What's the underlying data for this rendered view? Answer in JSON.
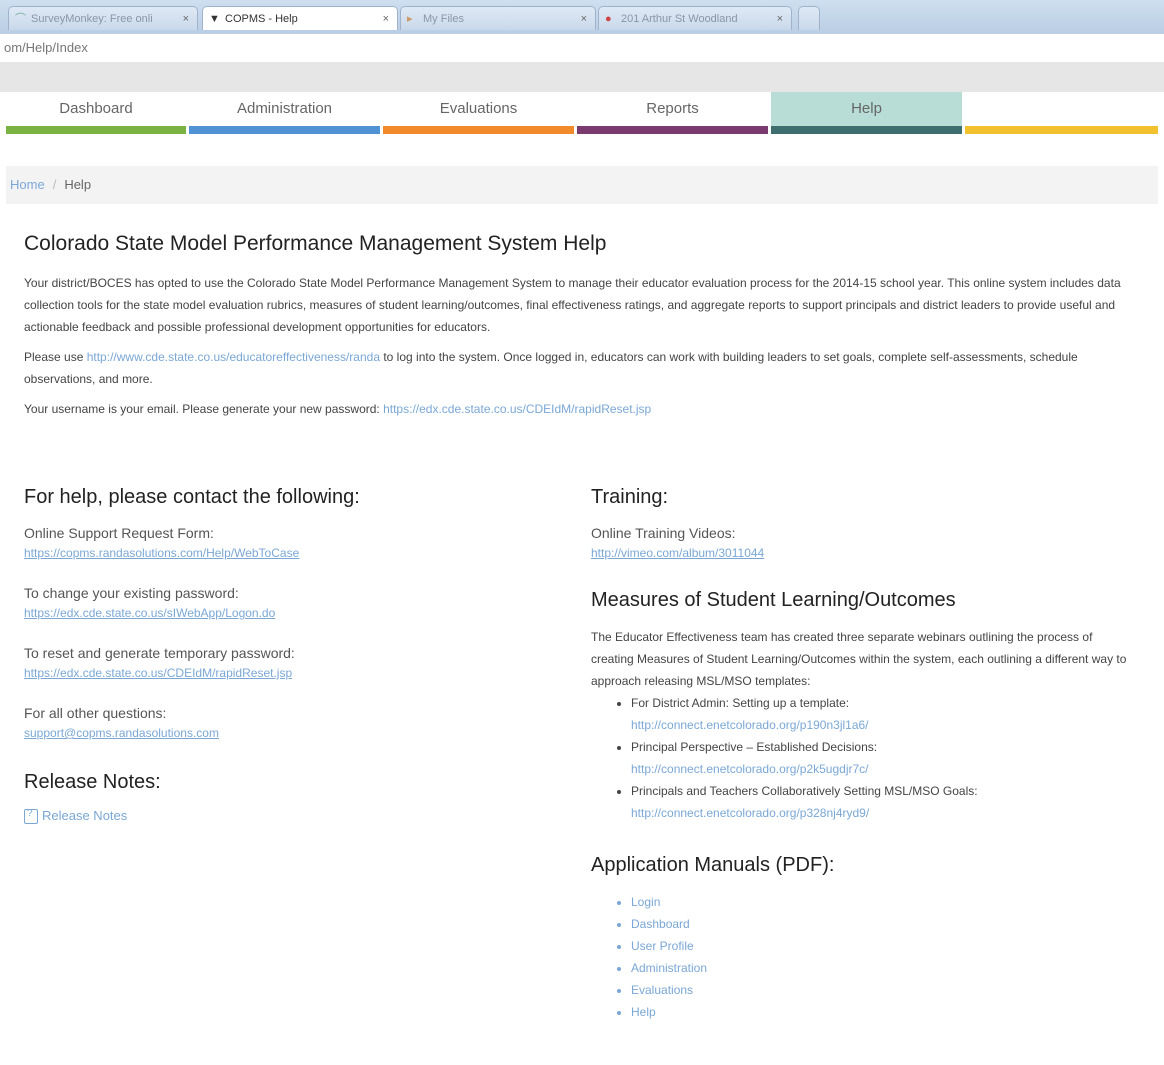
{
  "browser": {
    "tabs": [
      {
        "label": "SurveyMonkey: Free onli",
        "icon": "surveymonkey-icon",
        "active": false
      },
      {
        "label": "COPMS - Help",
        "icon": "copms-icon",
        "active": true
      },
      {
        "label": "My Files",
        "icon": "files-icon",
        "active": false
      },
      {
        "label": "201 Arthur St Woodland",
        "icon": "map-icon",
        "active": false
      }
    ],
    "close_glyph": "×",
    "address": "om/Help/Index"
  },
  "nav": {
    "items": [
      {
        "label": "Dashboard",
        "color": "#7ab342"
      },
      {
        "label": "Administration",
        "color": "#4f93d4"
      },
      {
        "label": "Evaluations",
        "color": "#f08a2a"
      },
      {
        "label": "Reports",
        "color": "#7b3b6e"
      },
      {
        "label": "Help",
        "color": "#3f6e6e"
      },
      {
        "label": "",
        "color": "#f2c12e"
      }
    ],
    "active": "Help"
  },
  "breadcrumb": {
    "home": "Home",
    "separator": "/",
    "current": "Help"
  },
  "main": {
    "title": "Colorado State Model Performance Management System Help",
    "intro": "Your district/BOCES has opted to use the Colorado State Model Performance Management System to manage their educator evaluation process for the 2014-15 school year. This online system includes data collection tools for the state model evaluation rubrics, measures of student learning/outcomes, final effectiveness ratings, and aggregate reports to support principals and district leaders to provide useful and actionable feedback and possible professional development opportunities for educators.",
    "login_pre": "Please use ",
    "login_url": "http://www.cde.state.co.us/educatoreffectiveness/randa",
    "login_post": " to log into the system. Once logged in, educators can work with building leaders to set goals, complete self-assessments, schedule observations, and more.",
    "username_pre": "Your username is your email. Please generate your new password: ",
    "username_url": "https://edx.cde.state.co.us/CDEIdM/rapidReset.jsp"
  },
  "help": {
    "title": "For help, please contact the following:",
    "items": [
      {
        "label": "Online Support Request Form:",
        "url": "https://copms.randasolutions.com/Help/WebToCase"
      },
      {
        "label": "To change your existing password:",
        "url": "https://edx.cde.state.co.us/sIWebApp/Logon.do"
      },
      {
        "label": "To reset and generate temporary password:",
        "url": "https://edx.cde.state.co.us/CDEIdM/rapidReset.jsp"
      },
      {
        "label": "For all other questions:",
        "url": "support@copms.randasolutions.com"
      }
    ]
  },
  "release": {
    "title": "Release Notes:",
    "link": "Release Notes"
  },
  "training": {
    "title": "Training:",
    "label": "Online Training Videos:",
    "url": "http://vimeo.com/album/3011044"
  },
  "msl": {
    "title": "Measures of Student Learning/Outcomes",
    "text": "The Educator Effectiveness team has created three separate webinars outlining the process of creating Measures of Student Learning/Outcomes within the system, each outlining a different way to approach releasing MSL/MSO templates:",
    "items": [
      {
        "label": "For District Admin: Setting up a template:",
        "url": "http://connect.enetcolorado.org/p190n3jl1a6/"
      },
      {
        "label": "Principal Perspective – Established Decisions:",
        "url": "http://connect.enetcolorado.org/p2k5ugdjr7c/"
      },
      {
        "label": "Principals and Teachers Collaboratively Setting MSL/MSO Goals:",
        "url": "http://connect.enetcolorado.org/p328nj4ryd9/"
      }
    ]
  },
  "manuals": {
    "title": "Application Manuals (PDF):",
    "items": [
      "Login",
      "Dashboard",
      "User Profile",
      "Administration",
      "Evaluations",
      "Help"
    ]
  }
}
